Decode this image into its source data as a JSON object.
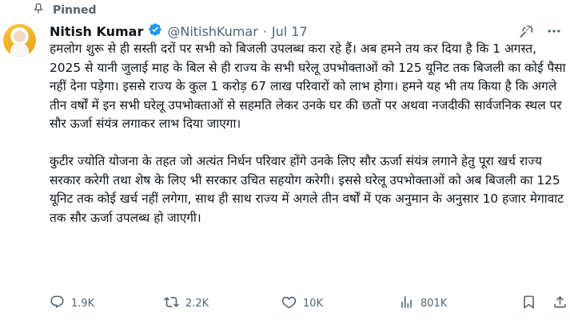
{
  "pinned": {
    "label": "Pinned",
    "icon": "pin-icon"
  },
  "author": {
    "name": "Nitish Kumar",
    "handle": "@NitishKumar",
    "separator": "·",
    "date": "Jul 17",
    "verified_color": "#1d9bf0"
  },
  "tweet": {
    "paragraph1": "हमलोग शुरू से ही सस्ती दरों पर सभी को बिजली उपलब्ध करा रहे हैं। अब हमने तय कर दिया है कि 1 अगस्त, 2025 से यानी जुलाई माह के बिल से ही राज्य के सभी घरेलू उपभोक्ताओं को 125 यूनिट तक बिजली का कोई पैसा नहीं देना पड़ेगा। इससे राज्य के कुल 1 करोड़ 67 लाख परिवारों को लाभ होगा। हमने यह भी तय किया है कि अगले तीन वर्षों में इन सभी घरेलू उपभोक्ताओं से सहमति लेकर उनके घर की छतों पर अथवा नजदीकी सार्वजनिक स्थल पर सौर ऊर्जा संयंत्र लगाकर लाभ दिया जाएगा।",
    "paragraph2": "कुटीर ज्योति योजना के तहत जो अत्यंत निर्धन परिवार होंगे उनके लिए सौर ऊर्जा संयंत्र लगाने हेतु पूरा खर्च राज्य सरकार करेगी तथा शेष के लिए भी सरकार उचित सहयोग करेगी। इससे घरेलू उपभोक्ताओं को अब बिजली का 125 यूनिट तक कोई खर्च नहीं लगेगा, साथ ही साथ राज्य में अगले तीन वर्षों में एक अनुमान के अनुसार 10 हजार मेगावाट तक सौर ऊर्जा उपलब्ध हो जाएगी।"
  },
  "actions": {
    "replies": "1.9K",
    "reposts": "2.2K",
    "likes": "10K",
    "views": "801K"
  },
  "colors": {
    "text": "#0f1419",
    "secondary": "#536471",
    "accent": "#1d9bf0"
  }
}
